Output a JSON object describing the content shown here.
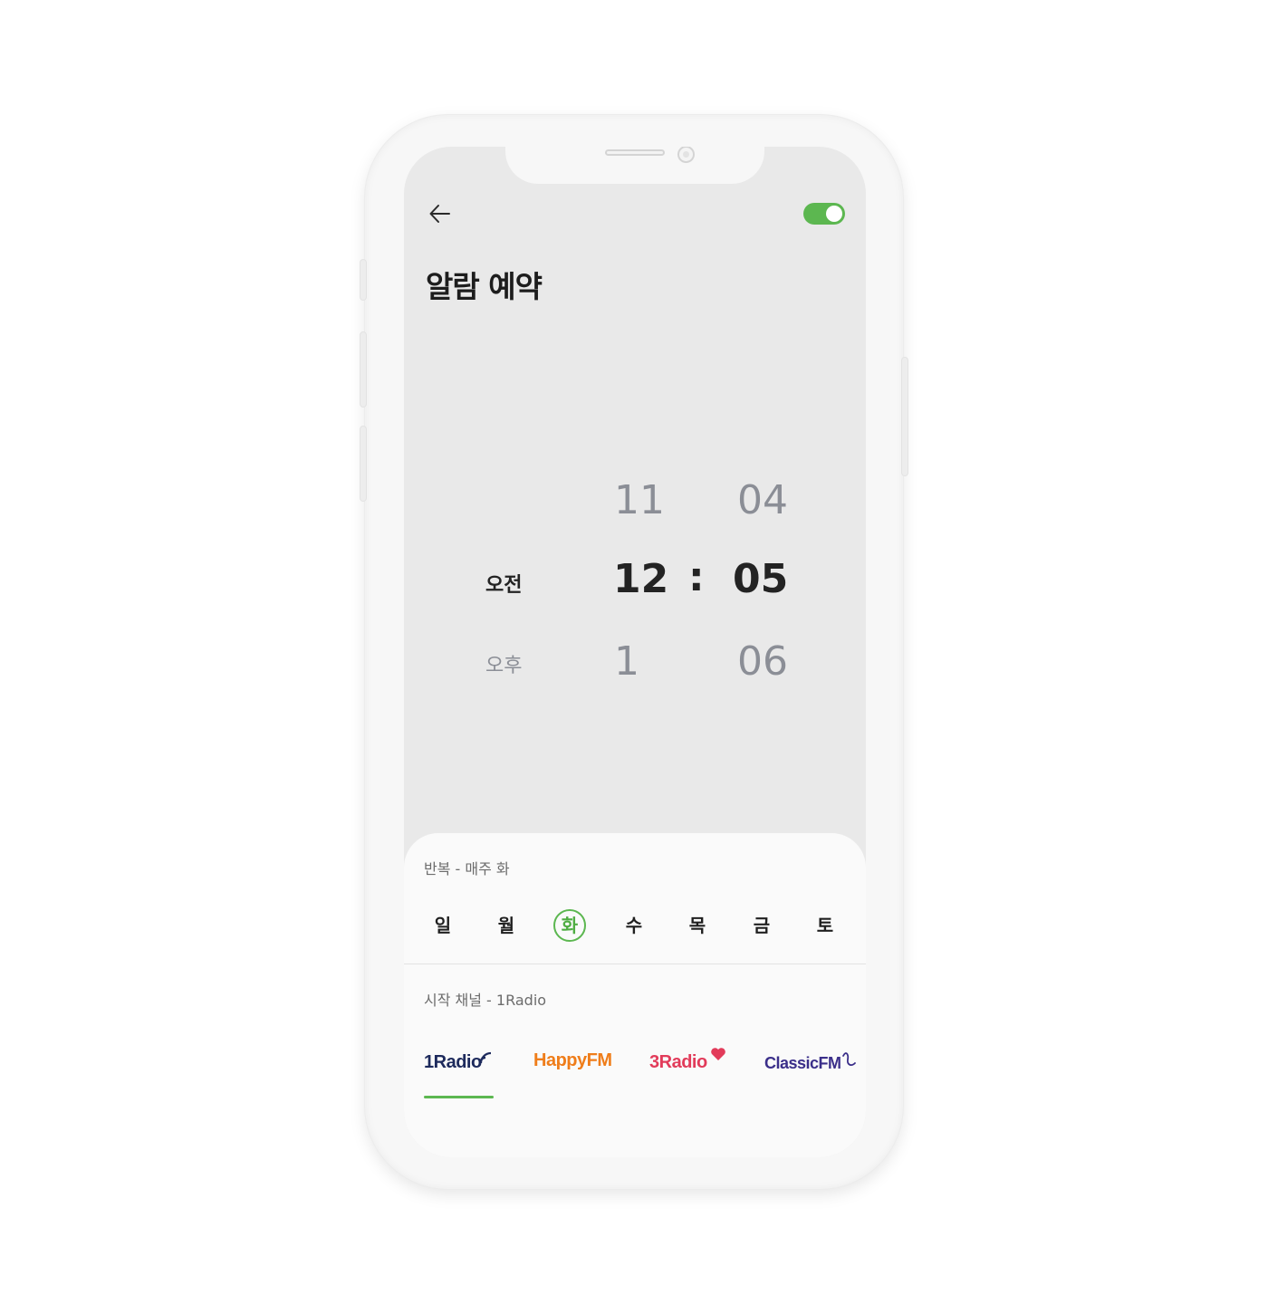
{
  "header": {
    "back_icon": "arrow-left-icon",
    "toggle_on": true,
    "accent_color": "#5cb750",
    "title": "알람 예약"
  },
  "picker": {
    "ampm": {
      "selected": "오전",
      "next": "오후"
    },
    "hour": {
      "prev": "11",
      "selected": "12",
      "next": "1"
    },
    "separator": ":",
    "minute": {
      "prev": "04",
      "selected": "05",
      "next": "06"
    }
  },
  "repeat": {
    "label": "반복 - 매주 화",
    "days": [
      "일",
      "월",
      "화",
      "수",
      "목",
      "금",
      "토"
    ],
    "active_day": "화"
  },
  "channel": {
    "label": "시작 채널 - 1Radio",
    "items": [
      {
        "name": "1Radio",
        "color": "#1d2a5c",
        "icon": "radio-waves-icon"
      },
      {
        "name": "HappyFM",
        "color": "#ef7d1a",
        "icon": ""
      },
      {
        "name": "3Radio",
        "color": "#e23b5a",
        "icon": "heart-icon"
      },
      {
        "name": "ClassicFM",
        "color": "#3b2f8a",
        "icon": "music-note-icon"
      }
    ],
    "selected": "1Radio"
  }
}
